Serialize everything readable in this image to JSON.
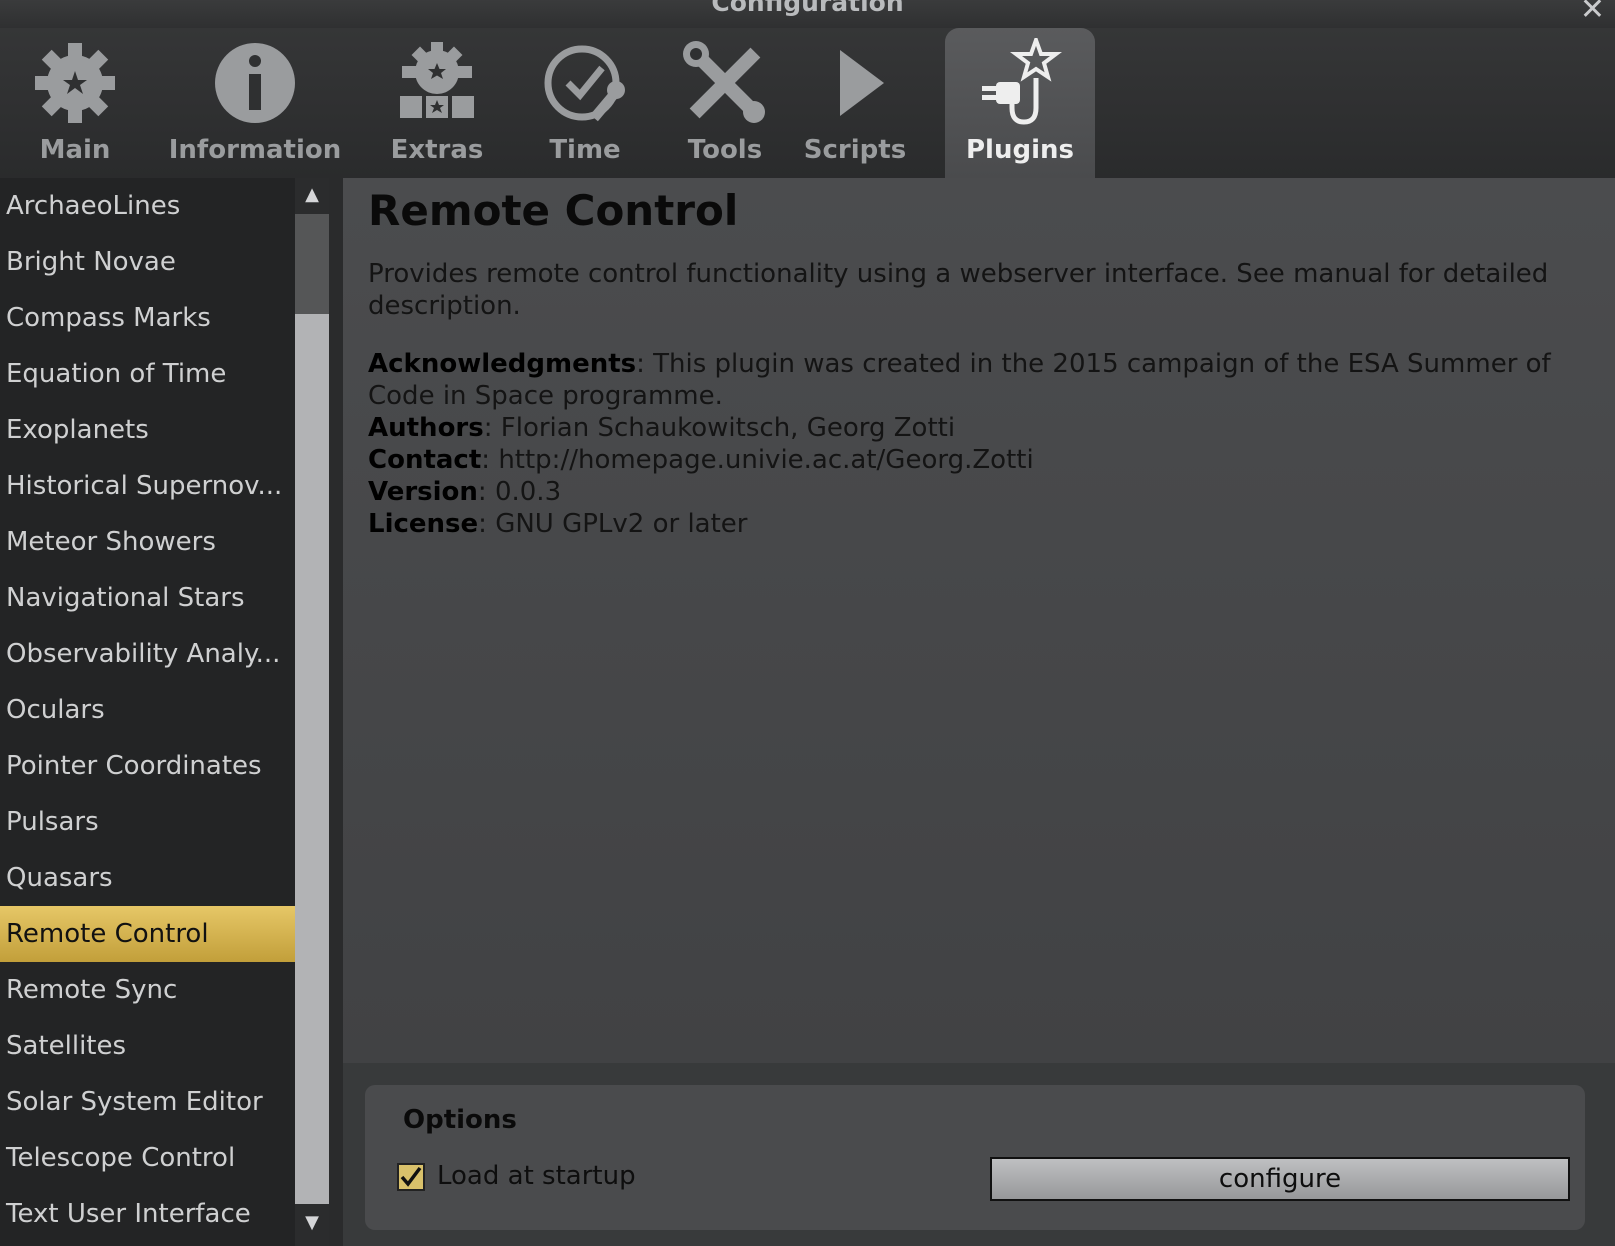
{
  "window": {
    "title": "Configuration"
  },
  "tabs": [
    {
      "label": "Main",
      "icon": "gear-star-icon"
    },
    {
      "label": "Information",
      "icon": "info-icon"
    },
    {
      "label": "Extras",
      "icon": "gear-extras-icon"
    },
    {
      "label": "Time",
      "icon": "clock-wrench-icon"
    },
    {
      "label": "Tools",
      "icon": "wrench-screwdriver-icon"
    },
    {
      "label": "Scripts",
      "icon": "play-icon"
    },
    {
      "label": "Plugins",
      "icon": "plug-star-icon",
      "active": true
    }
  ],
  "sidebar": {
    "items": [
      "ArchaeoLines",
      "Bright Novae",
      "Compass Marks",
      "Equation of Time",
      "Exoplanets",
      "Historical Supernov...",
      "Meteor Showers",
      "Navigational Stars",
      "Observability Analy...",
      "Oculars",
      "Pointer Coordinates",
      "Pulsars",
      "Quasars",
      "Remote Control",
      "Remote Sync",
      "Satellites",
      "Solar System Editor",
      "Telescope Control",
      "Text User Interface"
    ],
    "selected": "Remote Control"
  },
  "plugin": {
    "title": "Remote Control",
    "description": "Provides remote control functionality using a webserver interface. See manual for detailed description.",
    "acknowledgments_label": "Acknowledgments",
    "acknowledgments": "This plugin was created in the 2015 campaign of the ESA Summer of Code in Space programme.",
    "authors_label": "Authors",
    "authors": "Florian Schaukowitsch, Georg Zotti",
    "contact_label": "Contact",
    "contact": "http://homepage.univie.ac.at/Georg.Zotti",
    "version_label": "Version",
    "version": "0.0.3",
    "license_label": "License",
    "license": "GNU GPLv2 or later"
  },
  "options": {
    "title": "Options",
    "load_at_startup_label": "Load at startup",
    "load_at_startup": true,
    "configure_label": "configure"
  },
  "colors": {
    "selected": "#e6c767",
    "active_tab": "#5a5b5d"
  }
}
